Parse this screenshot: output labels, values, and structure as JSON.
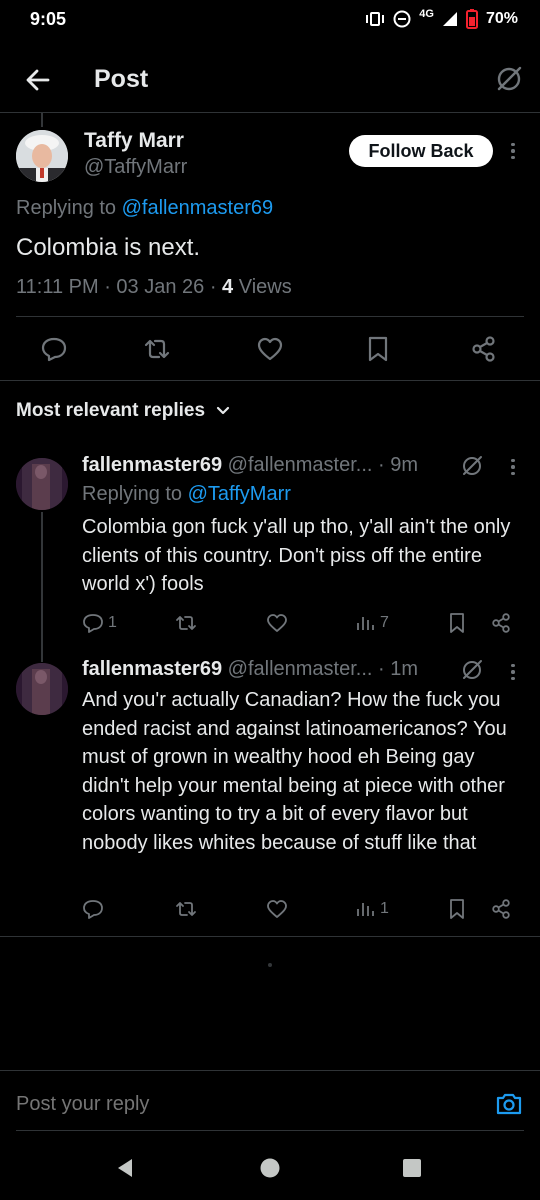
{
  "status_bar": {
    "time": "9:05",
    "network": "4G",
    "battery": "70%"
  },
  "header": {
    "title": "Post"
  },
  "main_post": {
    "display_name": "Taffy Marr",
    "handle": "@TaffyMarr",
    "follow_label": "Follow Back",
    "replying_prefix": "Replying to",
    "replying_to": "@fallenmaster69",
    "text": "Colombia is next.",
    "meta": "11:11 PM · 03 Jan 26 · ",
    "views_count": "4",
    "views_label": " Views"
  },
  "replies_sort": {
    "label": "Most relevant replies"
  },
  "replies": [
    {
      "display_name": "fallenmaster69",
      "handle": "@fallenmaster...",
      "time": "· 9m",
      "replying_prefix": "Replying to",
      "replying_to": "@TaffyMarr",
      "text": "Colombia gon fuck y'all up tho, y'all ain't the only clients of this country. Don't piss off the entire world x') fools",
      "reply_count": "1",
      "retweet_count": "",
      "like_count": "",
      "views_count": "7"
    },
    {
      "display_name": "fallenmaster69",
      "handle": "@fallenmaster...",
      "time": "· 1m",
      "text": "And you'r actually Canadian? How the fuck you ended racist and against latinoamericanos? You must of grown in wealthy hood eh Being gay didn't help your mental being at piece with other colors wanting to try a bit of every flavor but nobody likes whites because of stuff like that",
      "reply_count": "",
      "retweet_count": "",
      "like_count": "",
      "views_count": "1"
    }
  ],
  "composer": {
    "placeholder": "Post your reply"
  },
  "icons": {
    "back": "back-arrow-icon",
    "grok": "grok-icon",
    "reply": "reply-icon",
    "retweet": "retweet-icon",
    "like": "heart-icon",
    "bookmark": "bookmark-icon",
    "share": "share-icon",
    "views": "views-icon",
    "camera": "camera-icon"
  },
  "colors": {
    "background": "#000000",
    "accent": "#1d9bf0",
    "muted": "#71767b",
    "text": "#e7e9ea"
  }
}
